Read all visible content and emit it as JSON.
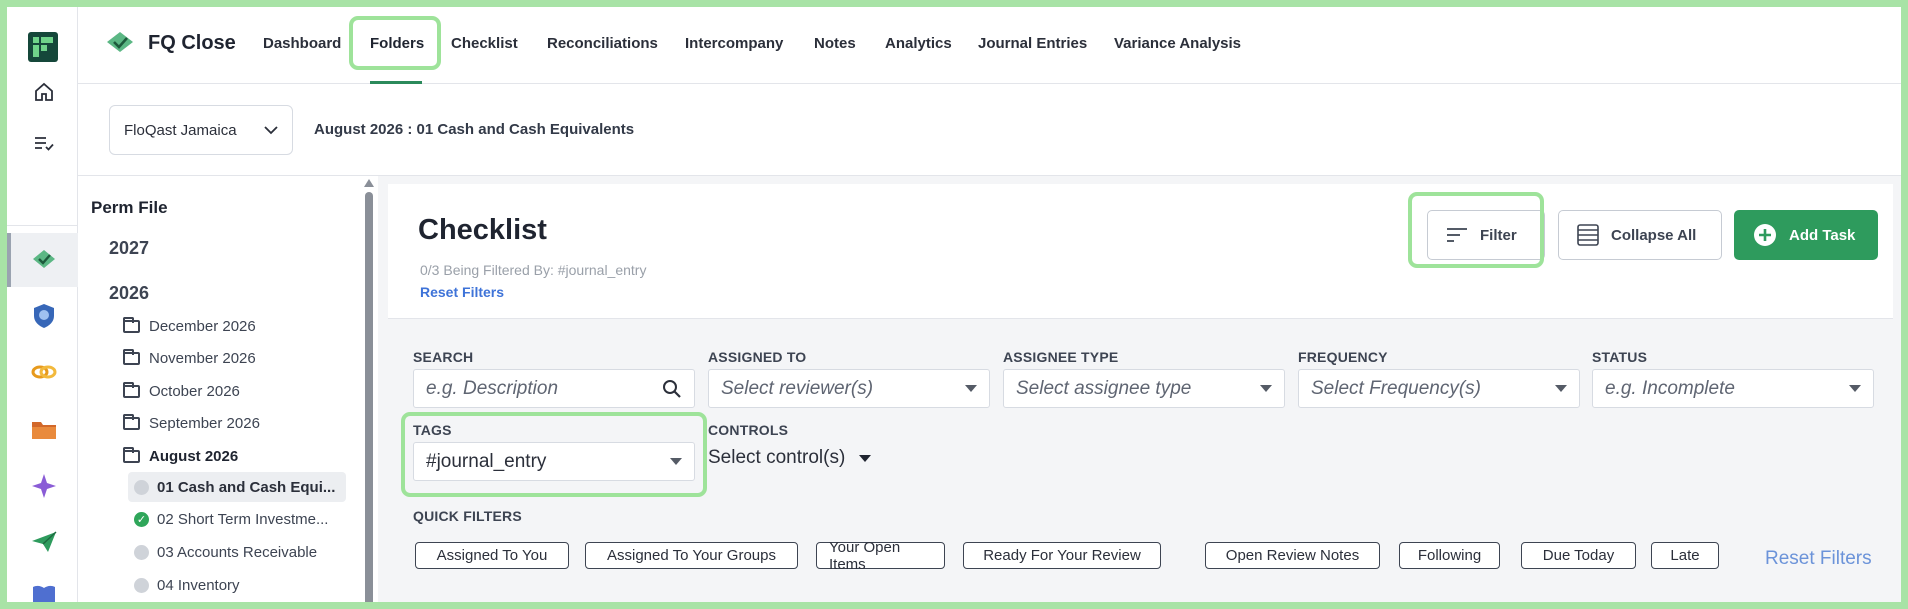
{
  "app": {
    "name": "FQ Close"
  },
  "nav": {
    "tabs": [
      {
        "label": "Dashboard"
      },
      {
        "label": "Folders"
      },
      {
        "label": "Checklist"
      },
      {
        "label": "Reconciliations"
      },
      {
        "label": "Intercompany"
      },
      {
        "label": "Notes"
      },
      {
        "label": "Analytics"
      },
      {
        "label": "Journal Entries"
      },
      {
        "label": "Variance Analysis"
      }
    ],
    "active": "Folders"
  },
  "subheader": {
    "entity": "FloQast Jamaica",
    "breadcrumb": "August 2026 : 01 Cash and Cash Equivalents"
  },
  "folders": {
    "heading": "Perm File",
    "years": [
      "2027",
      "2026"
    ],
    "months": [
      {
        "label": "December 2026"
      },
      {
        "label": "November 2026"
      },
      {
        "label": "October 2026"
      },
      {
        "label": "September 2026"
      },
      {
        "label": "August 2026"
      }
    ],
    "files": [
      {
        "label": "01 Cash and Cash Equi...",
        "status": "open"
      },
      {
        "label": "02 Short Term Investme...",
        "status": "done"
      },
      {
        "label": "03 Accounts Receivable",
        "status": "open"
      },
      {
        "label": "04 Inventory",
        "status": "open"
      }
    ]
  },
  "checklist": {
    "title": "Checklist",
    "filtered_by": "0/3 Being Filtered By: #journal_entry",
    "reset_filters": "Reset Filters",
    "buttons": {
      "filter": "Filter",
      "collapse_all": "Collapse All",
      "add_task": "Add Task"
    }
  },
  "filters": {
    "search": {
      "label": "SEARCH",
      "placeholder": "e.g. Description"
    },
    "assigned_to": {
      "label": "ASSIGNED TO",
      "placeholder": "Select reviewer(s)"
    },
    "assignee_type": {
      "label": "ASSIGNEE TYPE",
      "placeholder": "Select assignee type"
    },
    "frequency": {
      "label": "FREQUENCY",
      "placeholder": "Select Frequency(s)"
    },
    "status": {
      "label": "STATUS",
      "placeholder": "e.g. Incomplete"
    },
    "tags": {
      "label": "TAGS",
      "value": "#journal_entry"
    },
    "controls": {
      "label": "CONTROLS",
      "value": "Select control(s)"
    }
  },
  "quick_filters": {
    "label": "QUICK FILTERS",
    "items": [
      "Assigned To You",
      "Assigned To Your Groups",
      "Your Open Items",
      "Ready For Your Review",
      "Open Review Notes",
      "Following",
      "Due Today",
      "Late"
    ],
    "reset": "Reset Filters"
  },
  "colors": {
    "accent_green": "#2e9b5d",
    "highlight": "#9ee39a",
    "link_blue": "#3e73d8"
  }
}
